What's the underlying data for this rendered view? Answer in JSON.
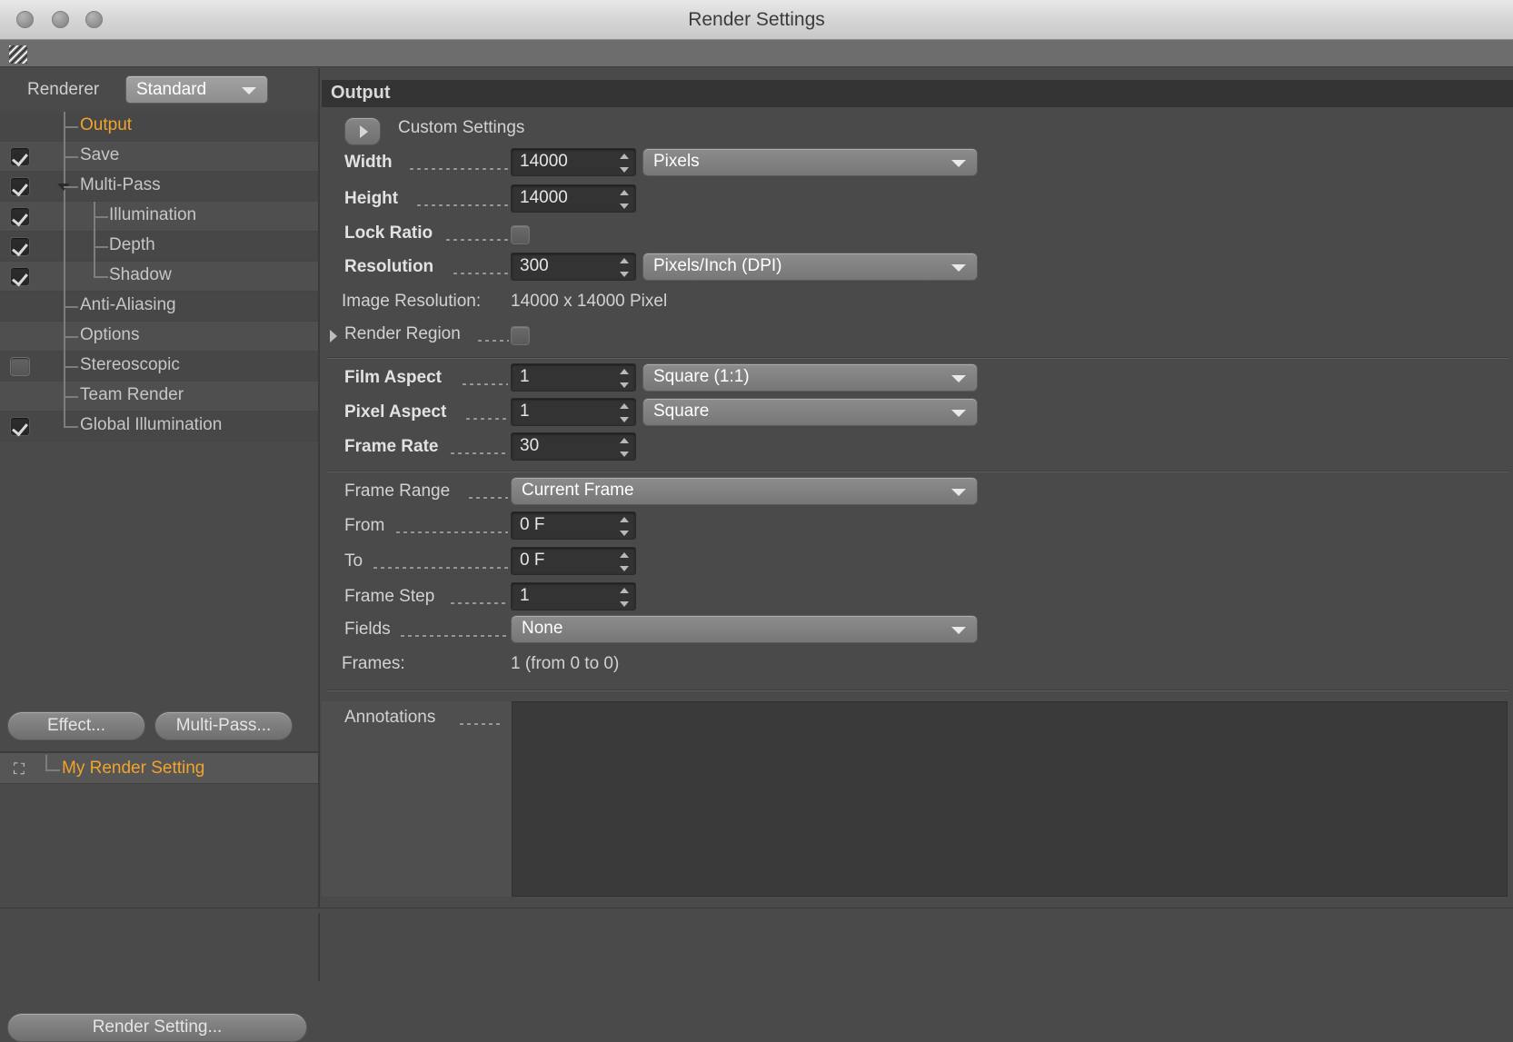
{
  "window": {
    "title": "Render Settings",
    "traffic_lights": [
      "close",
      "minimize",
      "zoom"
    ],
    "toolbar_grip": "drag-grip-icon"
  },
  "sidebar": {
    "renderer": {
      "label": "Renderer",
      "value": "Standard"
    },
    "tree": [
      {
        "label": "Output",
        "checkbox": "none",
        "selected": true,
        "depth": 1
      },
      {
        "label": "Save",
        "checkbox": "checked",
        "selected": false,
        "depth": 1
      },
      {
        "label": "Multi-Pass",
        "checkbox": "checked",
        "selected": false,
        "depth": 1,
        "expanded": true
      },
      {
        "label": "Illumination",
        "checkbox": "checked",
        "selected": false,
        "depth": 2
      },
      {
        "label": "Depth",
        "checkbox": "checked",
        "selected": false,
        "depth": 2
      },
      {
        "label": "Shadow",
        "checkbox": "checked",
        "selected": false,
        "depth": 2
      },
      {
        "label": "Anti-Aliasing",
        "checkbox": "none",
        "selected": false,
        "depth": 1
      },
      {
        "label": "Options",
        "checkbox": "none",
        "selected": false,
        "depth": 1
      },
      {
        "label": "Stereoscopic",
        "checkbox": "unchecked",
        "selected": false,
        "depth": 1
      },
      {
        "label": "Team Render",
        "checkbox": "none",
        "selected": false,
        "depth": 1
      },
      {
        "label": "Global Illumination",
        "checkbox": "checked",
        "selected": false,
        "depth": 1
      }
    ],
    "buttons": {
      "effect": "Effect...",
      "multipass": "Multi-Pass...",
      "render_setting": "Render Setting..."
    },
    "current_setting": {
      "label": "My Render Setting",
      "icon": "render-setting-icon",
      "color": "#f2a42a"
    }
  },
  "output": {
    "header": "Output",
    "custom_settings_label": "Custom Settings",
    "custom_settings_toggle": "collapsed-arrow-icon",
    "width": {
      "label": "Width",
      "value": "14000",
      "unit": "Pixels"
    },
    "height": {
      "label": "Height",
      "value": "14000"
    },
    "lock_ratio": {
      "label": "Lock Ratio",
      "checked": false
    },
    "resolution": {
      "label": "Resolution",
      "value": "300",
      "unit": "Pixels/Inch (DPI)"
    },
    "image_resolution": {
      "label": "Image Resolution:",
      "value": "14000 x 14000 Pixel"
    },
    "render_region": {
      "label": "Render Region",
      "checked": false
    },
    "film_aspect": {
      "label": "Film Aspect",
      "value": "1",
      "preset": "Square (1:1)"
    },
    "pixel_aspect": {
      "label": "Pixel Aspect",
      "value": "1",
      "preset": "Square"
    },
    "frame_rate": {
      "label": "Frame Rate",
      "value": "30"
    },
    "frame_range": {
      "label": "Frame Range",
      "value": "Current Frame"
    },
    "from": {
      "label": "From",
      "value": "0 F"
    },
    "to": {
      "label": "To",
      "value": "0 F"
    },
    "frame_step": {
      "label": "Frame Step",
      "value": "1"
    },
    "fields": {
      "label": "Fields",
      "value": "None"
    },
    "frames": {
      "label": "Frames:",
      "value": "1 (from 0 to 0)"
    },
    "annotations": {
      "label": "Annotations",
      "value": ""
    }
  },
  "colors": {
    "accent": "#f2a42a",
    "panel_bg": "#4a4a4a",
    "header_bg": "#333333",
    "field_bg": "#333333",
    "dropdown_bg": "#8c8c8c",
    "text": "#d2d2d2"
  }
}
